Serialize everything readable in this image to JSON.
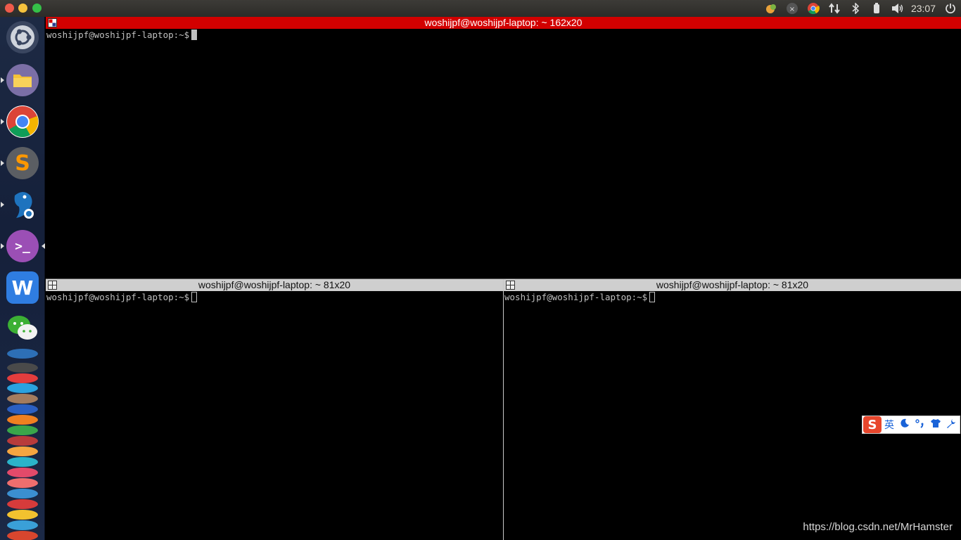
{
  "panel": {
    "clock": "23:07",
    "tray_icons": [
      "weather-icon",
      "network-icon",
      "chrome-tray-icon",
      "transfer-arrows-icon",
      "bluetooth-icon",
      "battery-icon",
      "volume-icon",
      "power-icon"
    ]
  },
  "launcher": {
    "apps": [
      "ubuntu-dash",
      "files",
      "chrome",
      "sublime-text",
      "dolphin-app",
      "terminal",
      "wps-writer",
      "wechat"
    ]
  },
  "terminals": {
    "top": {
      "title": "woshijpf@woshijpf-laptop: ~ 162x20",
      "prompt": "woshijpf@woshijpf-laptop:~$",
      "active": true
    },
    "bottom_left": {
      "title": "woshijpf@woshijpf-laptop: ~ 81x20",
      "prompt": "woshijpf@woshijpf-laptop:~$",
      "active": false
    },
    "bottom_right": {
      "title": "woshijpf@woshijpf-laptop: ~ 81x20",
      "prompt": "woshijpf@woshijpf-laptop:~$",
      "active": false
    }
  },
  "ime": {
    "logo": "S",
    "mode": "英",
    "icons": [
      "moon-icon",
      "punctuation-icon",
      "skin-icon",
      "settings-wrench-icon"
    ]
  },
  "watermark": "https://blog.csdn.net/MrHamster",
  "colors": {
    "active_title": "#d20000",
    "inactive_title": "#cfcfcf",
    "terminal_bg": "#000000",
    "terminal_fg": "#c0c0c0"
  }
}
